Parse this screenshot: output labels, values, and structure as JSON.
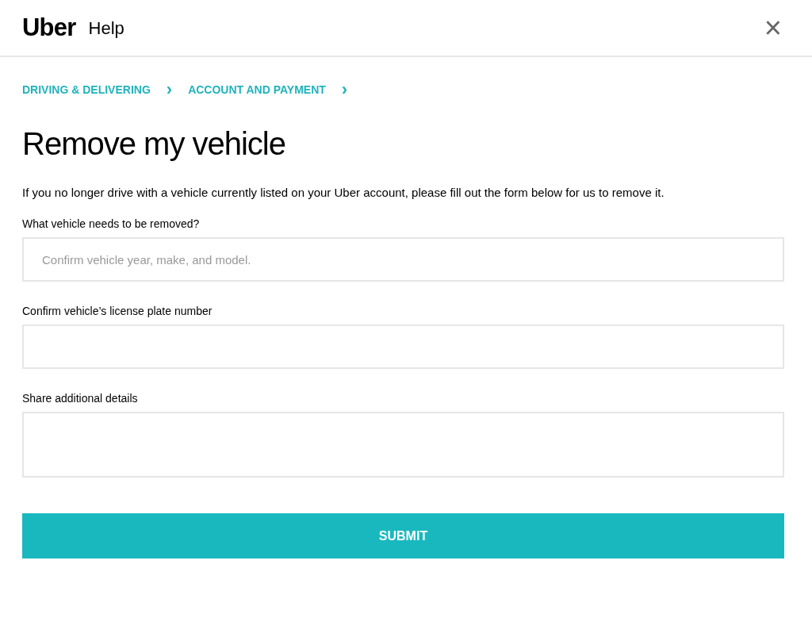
{
  "header": {
    "logo": "Uber",
    "title": "Help",
    "close": "×"
  },
  "breadcrumbs": [
    {
      "label": "DRIVING & DELIVERING",
      "separator": "›"
    },
    {
      "label": "ACCOUNT AND PAYMENT",
      "separator": "›"
    }
  ],
  "page_title": "Remove my vehicle",
  "intro": "If you no longer drive with a vehicle currently listed on your Uber account, please fill out the form below for us to remove it.",
  "fields": [
    {
      "kind": "input",
      "label": "What vehicle needs to be removed?",
      "placeholder": "Confirm vehicle year, make, and model."
    },
    {
      "kind": "input",
      "label": "Confirm vehicle’s license plate number"
    },
    {
      "kind": "textarea",
      "label": "Share additional details"
    }
  ],
  "submit": "SUBMIT"
}
